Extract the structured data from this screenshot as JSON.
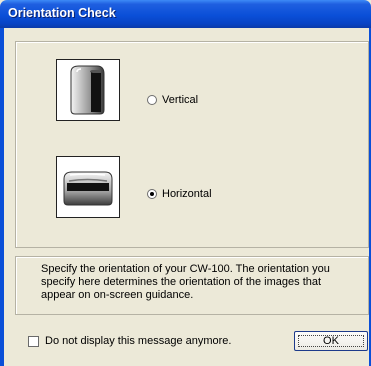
{
  "window": {
    "title": "Orientation Check"
  },
  "orientation": {
    "options": [
      {
        "label": "Vertical",
        "selected": false,
        "icon": "device-vertical-icon"
      },
      {
        "label": "Horizontal",
        "selected": true,
        "icon": "device-horizontal-icon"
      }
    ]
  },
  "description": "Specify the orientation of your CW-100. The orientation you specify here determines the orientation of the images that appear on on-screen guidance.",
  "footer": {
    "dont_show_label": "Do not display this message anymore.",
    "dont_show_checked": false,
    "ok_label": "OK"
  },
  "colors": {
    "title_bar": "#0a4fd8",
    "dialog_bg": "#ece9d8"
  }
}
